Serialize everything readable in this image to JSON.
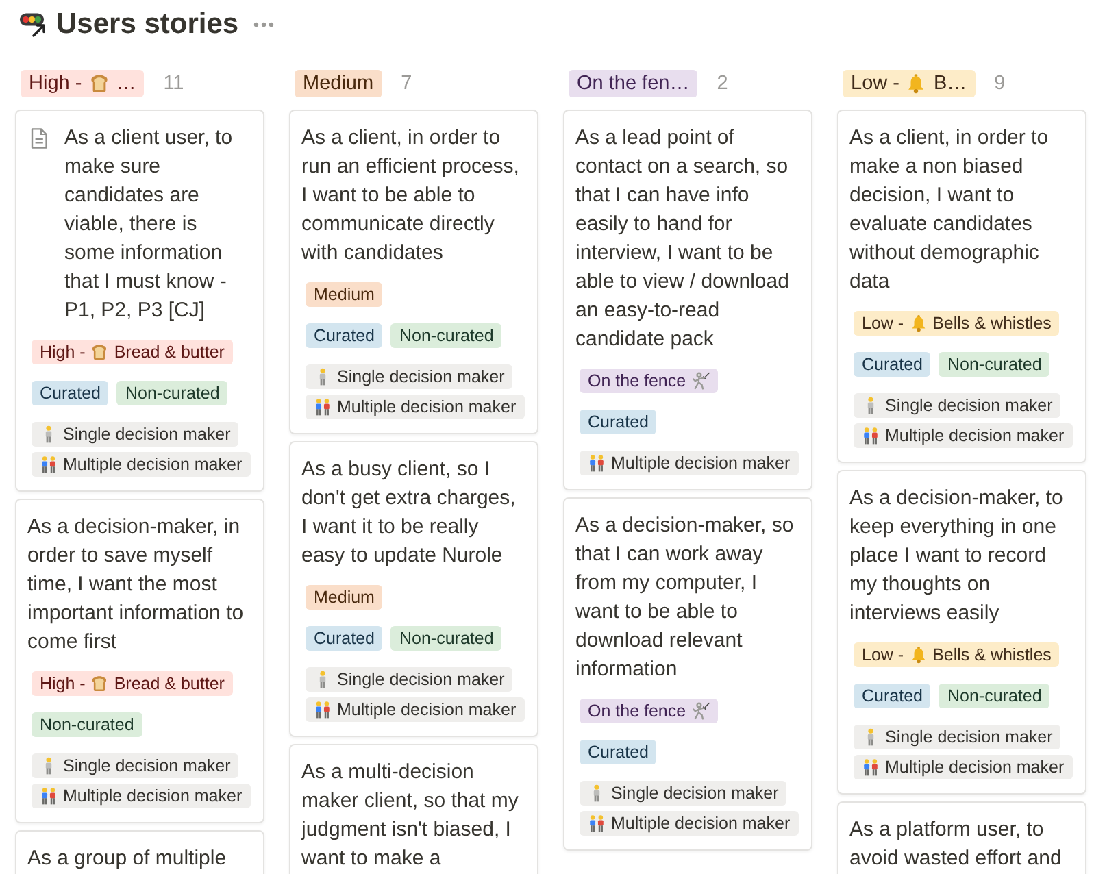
{
  "page": {
    "title": "Users stories"
  },
  "columns": [
    {
      "header": {
        "kind": "high",
        "text": "High -",
        "text_after": "…",
        "color": "#ffe2dd"
      },
      "count": "11",
      "cards": [
        {
          "page_icon": true,
          "text": "As a client user, to make sure candidates are viable, there is some information that I must know - P1, P2, P3 [CJ]",
          "rows": [
            {
              "tags": [
                {
                  "kind": "high",
                  "text": "High -",
                  "text_after": "Bread & butter",
                  "color": "#ffe2dd"
                }
              ]
            },
            {
              "tags": [
                {
                  "kind": "plain",
                  "text": "Curated",
                  "color": "#d3e5ef"
                },
                {
                  "kind": "plain",
                  "text": "Non-curated",
                  "color": "#dbeddb"
                }
              ]
            },
            {
              "tags": [
                {
                  "kind": "single",
                  "text": "Single decision maker",
                  "color": "#efeeec"
                },
                {
                  "kind": "multiple",
                  "text": "Multiple decision maker",
                  "color": "#efeeec"
                }
              ]
            }
          ]
        },
        {
          "page_icon": false,
          "text": "As a decision-maker, in order to save myself time, I want the most important information to come first",
          "rows": [
            {
              "tags": [
                {
                  "kind": "high",
                  "text": "High -",
                  "text_after": "Bread & butter",
                  "color": "#ffe2dd"
                }
              ]
            },
            {
              "tags": [
                {
                  "kind": "plain",
                  "text": "Non-curated",
                  "color": "#dbeddb"
                }
              ]
            },
            {
              "tags": [
                {
                  "kind": "single",
                  "text": "Single decision maker",
                  "color": "#efeeec"
                },
                {
                  "kind": "multiple",
                  "text": "Multiple decision maker",
                  "color": "#efeeec"
                }
              ]
            }
          ]
        },
        {
          "page_icon": false,
          "text": "As a group of multiple"
        }
      ]
    },
    {
      "header": {
        "kind": "plain",
        "text": "Medium",
        "color": "#fadec9"
      },
      "count": "7",
      "cards": [
        {
          "page_icon": false,
          "text": "As a client, in order to run an efficient process, I want to be able to communicate directly with candidates",
          "rows": [
            {
              "tags": [
                {
                  "kind": "plain",
                  "text": "Medium",
                  "color": "#fadec9"
                }
              ]
            },
            {
              "tags": [
                {
                  "kind": "plain",
                  "text": "Curated",
                  "color": "#d3e5ef"
                },
                {
                  "kind": "plain",
                  "text": "Non-curated",
                  "color": "#dbeddb"
                }
              ]
            },
            {
              "tags": [
                {
                  "kind": "single",
                  "text": "Single decision maker",
                  "color": "#efeeec"
                },
                {
                  "kind": "multiple",
                  "text": "Multiple decision maker",
                  "color": "#efeeec"
                }
              ]
            }
          ]
        },
        {
          "page_icon": false,
          "text": "As a busy client, so I don't get extra charges, I want it to be really easy to update Nurole",
          "rows": [
            {
              "tags": [
                {
                  "kind": "plain",
                  "text": "Medium",
                  "color": "#fadec9"
                }
              ]
            },
            {
              "tags": [
                {
                  "kind": "plain",
                  "text": "Curated",
                  "color": "#d3e5ef"
                },
                {
                  "kind": "plain",
                  "text": "Non-curated",
                  "color": "#dbeddb"
                }
              ]
            },
            {
              "tags": [
                {
                  "kind": "single",
                  "text": "Single decision maker",
                  "color": "#efeeec"
                },
                {
                  "kind": "multiple",
                  "text": "Multiple decision maker",
                  "color": "#efeeec"
                }
              ]
            }
          ]
        },
        {
          "page_icon": false,
          "text": "As a multi-decision maker client, so that my judgment isn't biased, I want to make a"
        }
      ]
    },
    {
      "header": {
        "kind": "plain",
        "text": "On the fen…",
        "color": "#e8deee"
      },
      "count": "2",
      "cards": [
        {
          "page_icon": false,
          "text": "As a lead point of contact on a search, so that I can have info easily to hand for interview, I want to be able to view / download an easy-to-read candidate pack",
          "rows": [
            {
              "tags": [
                {
                  "kind": "fence",
                  "text": "On the fence",
                  "color": "#e8deee"
                }
              ]
            },
            {
              "tags": [
                {
                  "kind": "plain",
                  "text": "Curated",
                  "color": "#d3e5ef"
                }
              ]
            },
            {
              "tags": [
                {
                  "kind": "multiple",
                  "text": "Multiple decision maker",
                  "color": "#efeeec"
                }
              ]
            }
          ]
        },
        {
          "page_icon": false,
          "text": "As a decision-maker, so that I can work away from my computer, I want to be able to download relevant information",
          "rows": [
            {
              "tags": [
                {
                  "kind": "fence",
                  "text": "On the fence",
                  "color": "#e8deee"
                }
              ]
            },
            {
              "tags": [
                {
                  "kind": "plain",
                  "text": "Curated",
                  "color": "#d3e5ef"
                }
              ]
            },
            {
              "tags": [
                {
                  "kind": "single",
                  "text": "Single decision maker",
                  "color": "#efeeec"
                },
                {
                  "kind": "multiple",
                  "text": "Multiple decision maker",
                  "color": "#efeeec"
                }
              ]
            }
          ]
        }
      ]
    },
    {
      "header": {
        "kind": "low",
        "text": "Low -",
        "text_after": "B…",
        "color": "#fdecc8"
      },
      "count": "9",
      "cards": [
        {
          "page_icon": false,
          "text": "As a client, in order to make a non biased decision, I want to evaluate candidates without demographic data",
          "rows": [
            {
              "tags": [
                {
                  "kind": "low",
                  "text": "Low -",
                  "text_after": "Bells & whistles",
                  "color": "#fdecc8"
                }
              ]
            },
            {
              "tags": [
                {
                  "kind": "plain",
                  "text": "Curated",
                  "color": "#d3e5ef"
                },
                {
                  "kind": "plain",
                  "text": "Non-curated",
                  "color": "#dbeddb"
                }
              ]
            },
            {
              "tags": [
                {
                  "kind": "single",
                  "text": "Single decision maker",
                  "color": "#efeeec"
                },
                {
                  "kind": "multiple",
                  "text": "Multiple decision maker",
                  "color": "#efeeec"
                }
              ]
            }
          ]
        },
        {
          "page_icon": false,
          "text": "As a decision-maker, to keep everything in one place I want to record my thoughts on interviews easily",
          "rows": [
            {
              "tags": [
                {
                  "kind": "low",
                  "text": "Low -",
                  "text_after": "Bells & whistles",
                  "color": "#fdecc8"
                }
              ]
            },
            {
              "tags": [
                {
                  "kind": "plain",
                  "text": "Curated",
                  "color": "#d3e5ef"
                },
                {
                  "kind": "plain",
                  "text": "Non-curated",
                  "color": "#dbeddb"
                }
              ]
            },
            {
              "tags": [
                {
                  "kind": "single",
                  "text": "Single decision maker",
                  "color": "#efeeec"
                },
                {
                  "kind": "multiple",
                  "text": "Multiple decision maker",
                  "color": "#efeeec"
                }
              ]
            }
          ]
        },
        {
          "page_icon": false,
          "text": "As a platform user, to avoid wasted effort and"
        }
      ]
    }
  ]
}
